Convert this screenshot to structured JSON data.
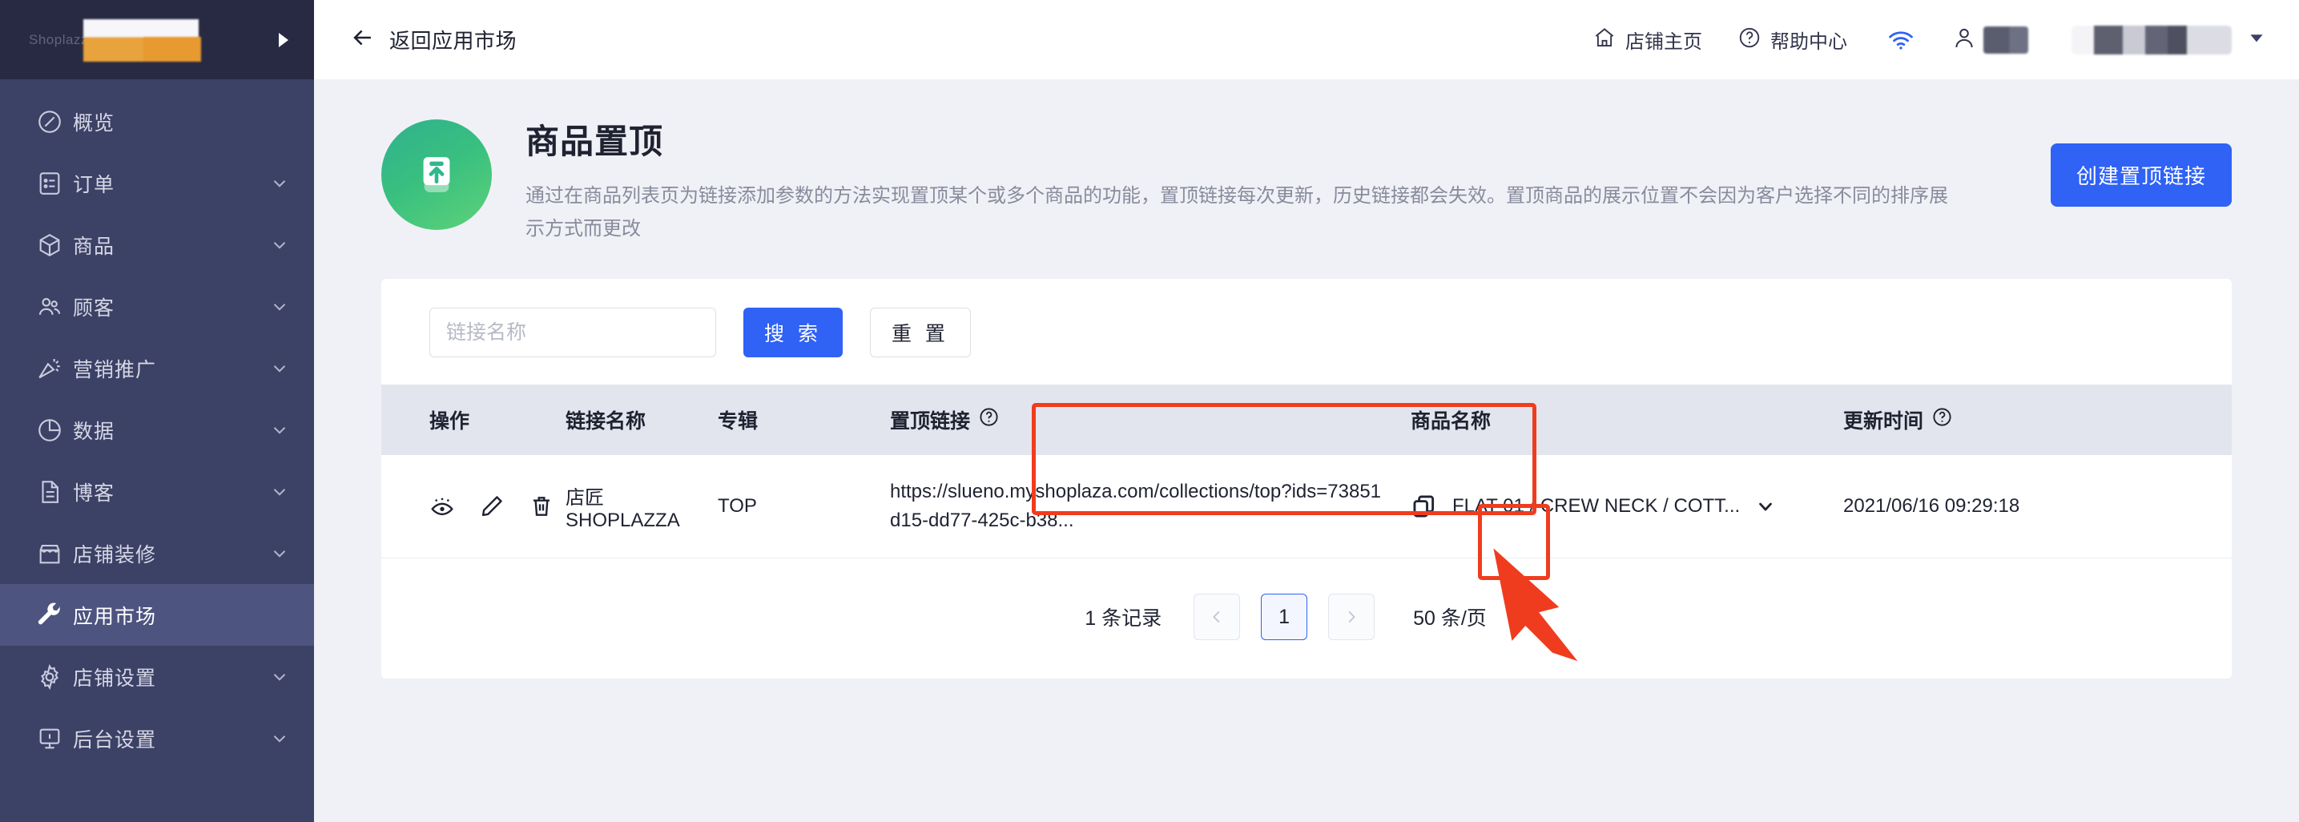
{
  "sidebar": {
    "brand": "Shoplazza",
    "collapse_icon": "play-triangle-icon",
    "items": [
      {
        "label": "概览",
        "icon": "compass-icon",
        "expandable": false,
        "active": false
      },
      {
        "label": "订单",
        "icon": "order-list-icon",
        "expandable": true,
        "active": false
      },
      {
        "label": "商品",
        "icon": "box-icon",
        "expandable": true,
        "active": false
      },
      {
        "label": "顾客",
        "icon": "users-icon",
        "expandable": true,
        "active": false
      },
      {
        "label": "营销推广",
        "icon": "megaphone-icon",
        "expandable": true,
        "active": false
      },
      {
        "label": "数据",
        "icon": "pie-chart-icon",
        "expandable": true,
        "active": false
      },
      {
        "label": "博客",
        "icon": "document-icon",
        "expandable": true,
        "active": false
      },
      {
        "label": "店铺装修",
        "icon": "storefront-icon",
        "expandable": true,
        "active": false
      },
      {
        "label": "应用市场",
        "icon": "wrench-icon",
        "expandable": false,
        "active": true
      },
      {
        "label": "店铺设置",
        "icon": "gear-icon",
        "expandable": true,
        "active": false
      },
      {
        "label": "后台设置",
        "icon": "server-icon",
        "expandable": true,
        "active": false
      }
    ]
  },
  "topbar": {
    "back_label": "返回应用市场",
    "back_icon": "arrow-left-icon",
    "store_home_label": "店铺主页",
    "store_home_icon": "home-icon",
    "help_label": "帮助中心",
    "help_icon": "question-circle-icon",
    "wifi_icon": "wifi-icon",
    "user_icon": "person-icon",
    "store_caret_icon": "chevron-down-icon"
  },
  "page_head": {
    "app_icon": "pin-to-top-icon",
    "title": "商品置顶",
    "description": "通过在商品列表页为链接添加参数的方法实现置顶某个或多个商品的功能，置顶链接每次更新，历史链接都会失效。置顶商品的展示位置不会因为客户选择不同的排序展示方式而更改",
    "create_button": "创建置顶链接"
  },
  "filter": {
    "name_placeholder": "链接名称",
    "name_value": "",
    "search_button": "搜 索",
    "reset_button": "重 置"
  },
  "table": {
    "columns": [
      {
        "key": "op",
        "label": "操作",
        "help": false
      },
      {
        "key": "name",
        "label": "链接名称",
        "help": false
      },
      {
        "key": "album",
        "label": "专辑",
        "help": false
      },
      {
        "key": "link",
        "label": "置顶链接",
        "help": true
      },
      {
        "key": "product",
        "label": "商品名称",
        "help": false
      },
      {
        "key": "time",
        "label": "更新时间",
        "help": true
      }
    ],
    "rows": [
      {
        "actions": [
          "preview-icon",
          "edit-icon",
          "delete-icon"
        ],
        "name": "店匠SHOPLAZZA",
        "album": "TOP",
        "link": "https://slueno.myshoplaza.com/collections/top?ids=73851d15-dd77-425c-b38...",
        "copy_icon": "copy-icon",
        "product": "FLAT 01 / CREW NECK / COTT...",
        "product_caret": "chevron-down-icon",
        "time": "2021/06/16 09:29:18"
      }
    ]
  },
  "pagination": {
    "total_text": "1 条记录",
    "prev_icon": "chevron-left-icon",
    "next_icon": "chevron-right-icon",
    "pages": [
      "1"
    ],
    "current_page": "1",
    "page_size_label": "50 条/页",
    "page_size_caret": "caret-down-icon"
  },
  "colors": {
    "sidebar_bg": "#3c4166",
    "sidebar_top_bg": "#272a42",
    "sidebar_active_bg": "#4e5480",
    "primary": "#2f62f5",
    "page_bg": "#f0f1f6",
    "table_header_bg": "#e3e5ee",
    "annotation_red": "#f03c1e",
    "app_badge_green": "#39c07f"
  },
  "annotations": [
    {
      "name": "link-column-highlight",
      "shape": "rectangle",
      "color": "#f03c1e"
    },
    {
      "name": "copy-button-highlight",
      "shape": "rectangle",
      "color": "#f03c1e"
    },
    {
      "name": "copy-button-pointer",
      "shape": "arrow",
      "color": "#f03c1e"
    }
  ]
}
